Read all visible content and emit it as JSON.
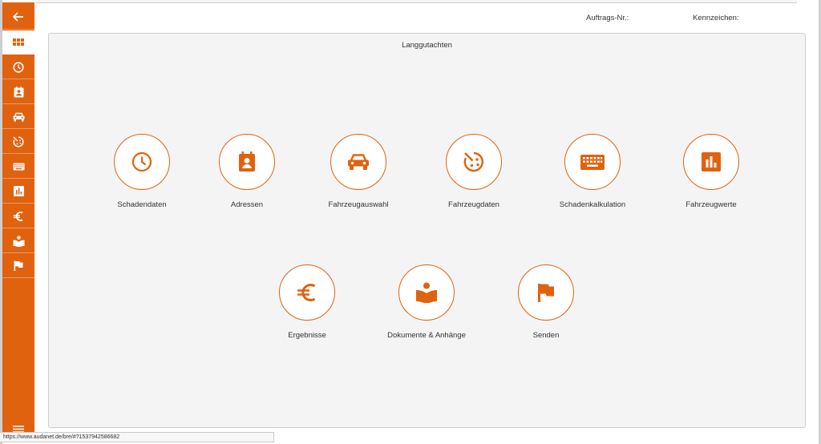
{
  "header": {
    "auftrags_label": "Auftrags-Nr.:",
    "kennzeichen_label": "Kennzeichen:"
  },
  "card": {
    "title": "Langgutachten"
  },
  "tiles": [
    {
      "label": "Schadendaten",
      "icon": "clock-icon"
    },
    {
      "label": "Adressen",
      "icon": "contact-icon"
    },
    {
      "label": "Fahrzeugauswahl",
      "icon": "car-icon"
    },
    {
      "label": "Fahrzeugdaten",
      "icon": "tire-icon"
    },
    {
      "label": "Schadenkalkulation",
      "icon": "keyboard-icon"
    },
    {
      "label": "Fahrzeugwerte",
      "icon": "bar-chart-icon"
    },
    {
      "label": "Ergebnisse",
      "icon": "euro-icon"
    },
    {
      "label": "Dokumente & Anhänge",
      "icon": "book-icon"
    },
    {
      "label": "Senden",
      "icon": "flag-icon"
    }
  ],
  "sidebar": {
    "items": [
      {
        "icon": "back-arrow-icon"
      },
      {
        "icon": "grid-icon",
        "active": true
      },
      {
        "icon": "clock-icon"
      },
      {
        "icon": "contact-icon"
      },
      {
        "icon": "car-icon"
      },
      {
        "icon": "tire-icon"
      },
      {
        "icon": "keyboard-icon"
      },
      {
        "icon": "bar-chart-icon"
      },
      {
        "icon": "euro-icon"
      },
      {
        "icon": "book-icon"
      },
      {
        "icon": "flag-icon"
      }
    ],
    "menu_icon": "hamburger-menu-icon"
  },
  "status_bar": {
    "url": "https://www.audanet.de/bre/#?1537942586682"
  },
  "colors": {
    "accent": "#e0620f",
    "background": "#f4f4f4",
    "text": "#333333"
  }
}
